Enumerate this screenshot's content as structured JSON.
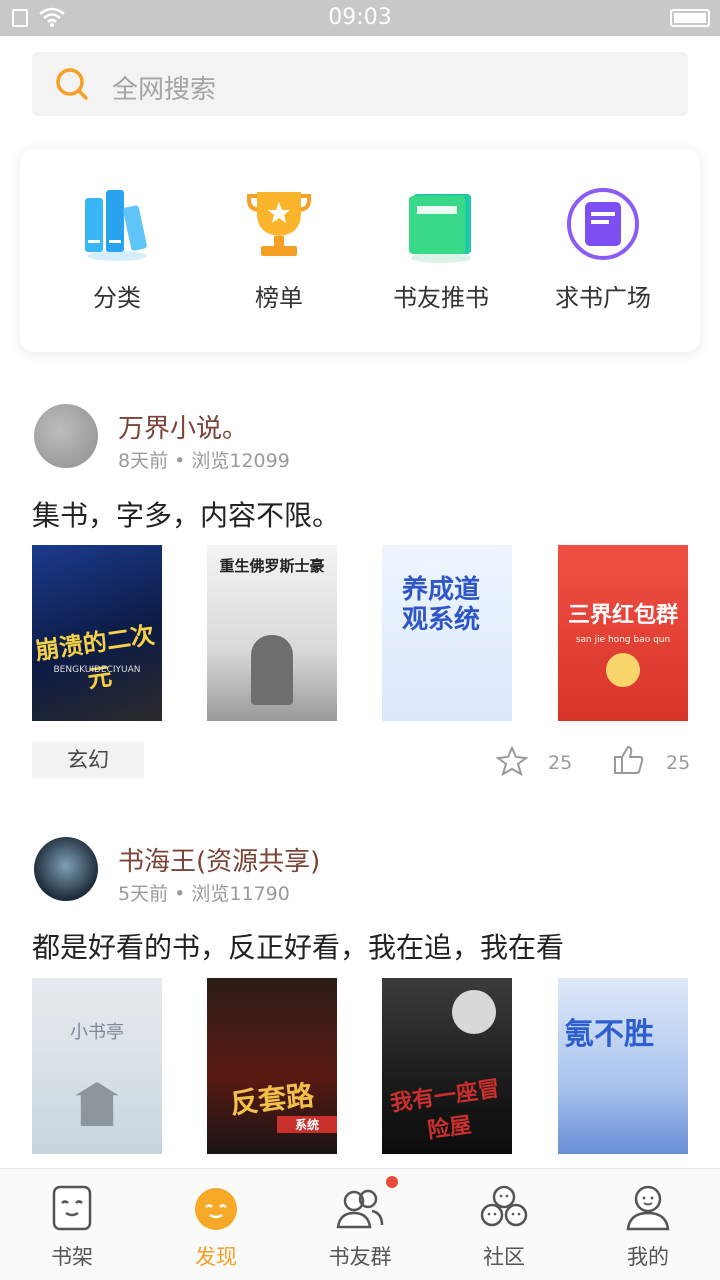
{
  "status_bar": {
    "time": "09:03"
  },
  "search": {
    "placeholder": "全网搜索"
  },
  "nav": [
    {
      "label": "分类",
      "icon": "category-books-icon"
    },
    {
      "label": "榜单",
      "icon": "trophy-icon"
    },
    {
      "label": "书友推书",
      "icon": "green-book-icon"
    },
    {
      "label": "求书广场",
      "icon": "purple-book-icon"
    }
  ],
  "posts": [
    {
      "author": "万界小说。",
      "meta": "8天前 • 浏览12099",
      "content": "集书，字多，内容不限。",
      "books": [
        {
          "title": "崩溃的二次元",
          "sub": "BENGKUIDECIYUAN"
        },
        {
          "title": "重生佛罗斯士豪",
          "sub": ""
        },
        {
          "title": "养成道观系统",
          "sub": ""
        },
        {
          "title": "三界红包群",
          "sub": "san jie hong bao qun"
        }
      ],
      "tag": "玄幻",
      "favorites": "25",
      "likes": "25"
    },
    {
      "author": "书海王(资源共享)",
      "meta": "5天前 • 浏览11790",
      "content": "都是好看的书，反正好看，我在追，我在看",
      "books": [
        {
          "title": "小书亭",
          "sub": ""
        },
        {
          "title": "反套路",
          "sub": "系统"
        },
        {
          "title": "我有一座冒险屋",
          "sub": ""
        },
        {
          "title": "氪不胜",
          "sub": ""
        }
      ]
    }
  ],
  "tabs": [
    {
      "label": "书架",
      "icon": "bookshelf-icon",
      "active": false
    },
    {
      "label": "发现",
      "icon": "discover-icon",
      "active": true
    },
    {
      "label": "书友群",
      "icon": "group-icon",
      "active": false
    },
    {
      "label": "社区",
      "icon": "community-icon",
      "active": false
    },
    {
      "label": "我的",
      "icon": "profile-icon",
      "active": false
    }
  ],
  "colors": {
    "accent": "#f5a025",
    "author": "#7b4438",
    "badge": "#e94a3a"
  }
}
